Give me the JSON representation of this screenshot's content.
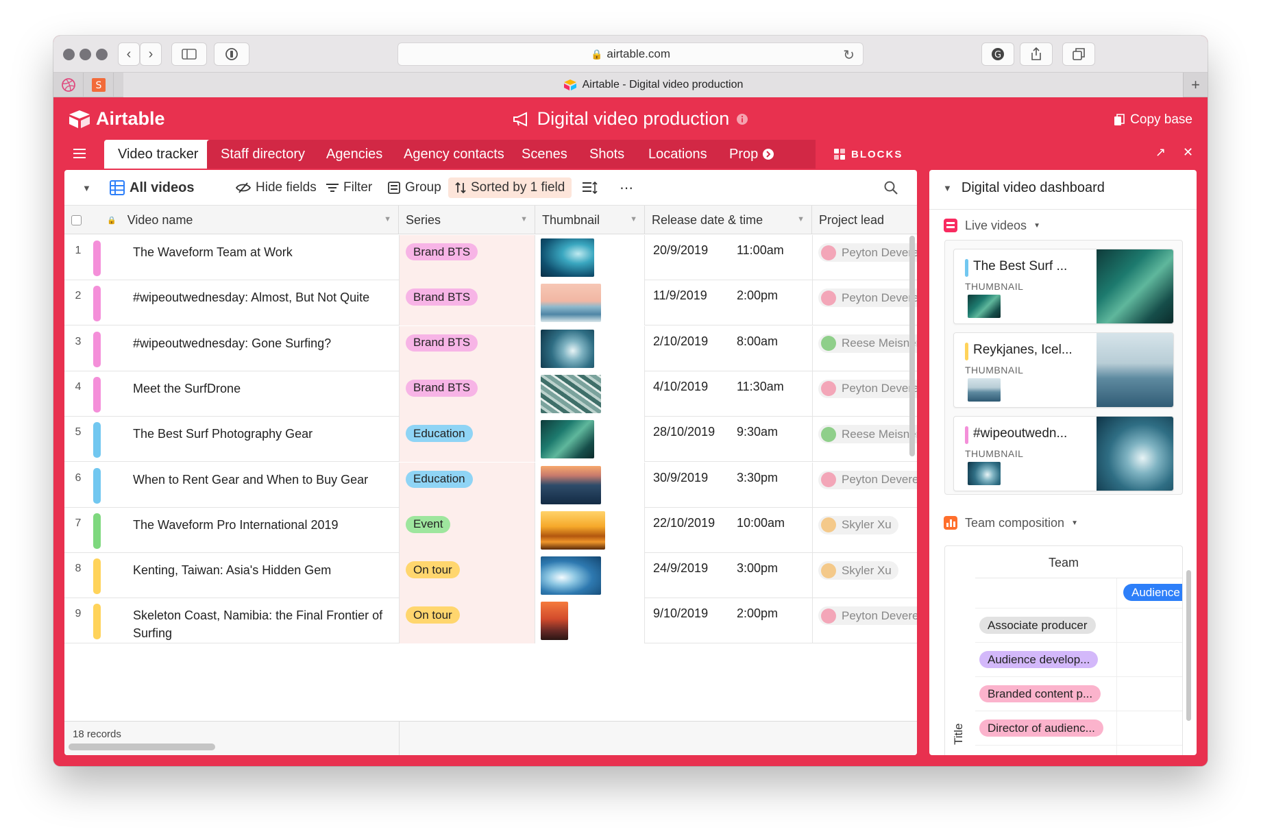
{
  "browser": {
    "url": "airtable.com",
    "tab_title": "Airtable - Digital video production"
  },
  "app": {
    "logo_text": "Airtable",
    "base_title": "Digital video production",
    "copy_base": "Copy base",
    "accent_color": "#e8314f"
  },
  "tables": [
    "Video tracker",
    "Staff directory",
    "Agencies",
    "Agency contacts",
    "Scenes",
    "Shots",
    "Locations",
    "Prop"
  ],
  "blocks": {
    "label": "BLOCKS"
  },
  "toolbar": {
    "view_name": "All videos",
    "hide_fields": "Hide fields",
    "filter": "Filter",
    "group": "Group",
    "sorted": "Sorted by 1 field"
  },
  "columns": [
    "Video name",
    "Series",
    "Thumbnail",
    "Release date & time",
    "Project lead"
  ],
  "series_colors": {
    "Brand BTS": "#f7b4e6",
    "Education": "#8fd4f5",
    "Event": "#9ee69e",
    "On tour": "#ffd66e"
  },
  "rows": [
    {
      "num": "1",
      "name": "The Waveform Team at Work",
      "series": "Brand BTS",
      "bar": "#f48fd9",
      "date": "20/9/2019",
      "time": "11:00am",
      "lead": "Peyton Devereux",
      "thumb": "wave-teal"
    },
    {
      "num": "2",
      "name": "#wipeoutwednesday: Almost, But Not Quite",
      "series": "Brand BTS",
      "bar": "#f48fd9",
      "date": "11/9/2019",
      "time": "2:00pm",
      "lead": "Peyton Devereux",
      "thumb": "sunset-surf"
    },
    {
      "num": "3",
      "name": "#wipeoutwednesday: Gone Surfing?",
      "series": "Brand BTS",
      "bar": "#f48fd9",
      "date": "2/10/2019",
      "time": "8:00am",
      "lead": "Reese Meisner",
      "thumb": "barrel"
    },
    {
      "num": "4",
      "name": "Meet the SurfDrone",
      "series": "Brand BTS",
      "bar": "#f48fd9",
      "date": "4/10/2019",
      "time": "11:30am",
      "lead": "Peyton Devereux",
      "thumb": "foam"
    },
    {
      "num": "5",
      "name": "The Best Surf Photography Gear",
      "series": "Education",
      "bar": "#71c7f0",
      "date": "28/10/2019",
      "time": "9:30am",
      "lead": "Reese Meisner",
      "thumb": "green-wave"
    },
    {
      "num": "6",
      "name": "When to Rent Gear and When to Buy Gear",
      "series": "Education",
      "bar": "#71c7f0",
      "date": "30/9/2019",
      "time": "3:30pm",
      "lead": "Peyton Devereux",
      "thumb": "dusk-surfer"
    },
    {
      "num": "7",
      "name": "The Waveform Pro International 2019",
      "series": "Event",
      "bar": "#7ed87e",
      "date": "22/10/2019",
      "time": "10:00am",
      "lead": "Skyler Xu",
      "thumb": "golden"
    },
    {
      "num": "8",
      "name": "Kenting, Taiwan: Asia's Hidden Gem",
      "series": "On tour",
      "bar": "#ffd35a",
      "date": "24/9/2019",
      "time": "3:00pm",
      "lead": "Skyler Xu",
      "thumb": "blue-curl"
    },
    {
      "num": "9",
      "name": "Skeleton Coast, Namibia: the Final Frontier of Surfing",
      "series": "On tour",
      "bar": "#ffd35a",
      "date": "9/10/2019",
      "time": "2:00pm",
      "lead": "Peyton Devereux",
      "thumb": "red-sea"
    }
  ],
  "footer": {
    "records": "18 records"
  },
  "dashboard": {
    "title": "Digital video dashboard",
    "live_videos": "Live videos",
    "cards": [
      {
        "title": "The Best Surf ...",
        "label": "THUMBNAIL",
        "bar": "#71c7f0",
        "thumb": "green-wave"
      },
      {
        "title": "Reykjanes, Icel...",
        "label": "THUMBNAIL",
        "bar": "#ffd35a",
        "thumb": "sea-grey"
      },
      {
        "title": "#wipeoutwedn...",
        "label": "THUMBNAIL",
        "bar": "#f48fd9",
        "thumb": "barrel"
      }
    ],
    "team_composition": "Team composition",
    "team_header": "Team",
    "audience": "Audience",
    "y_axis": "Title",
    "titles": [
      {
        "label": "Associate producer",
        "color": "#e2e2e2"
      },
      {
        "label": "Audience develop...",
        "color": "#d3b8fa"
      },
      {
        "label": "Branded content p...",
        "color": "#fbb3cc"
      },
      {
        "label": "Director of audienc...",
        "color": "#fbb3cc"
      }
    ]
  }
}
